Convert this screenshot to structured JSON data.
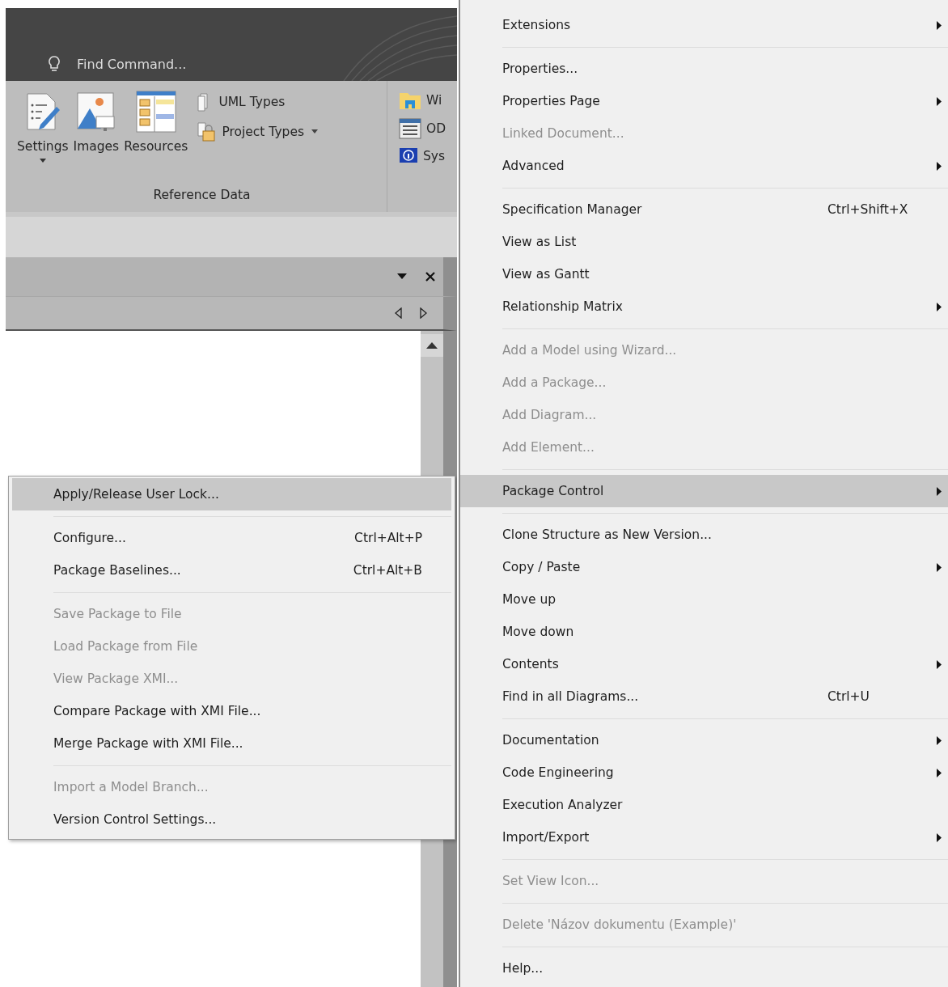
{
  "ribbon": {
    "search": {
      "placeholder": "Find Command..."
    },
    "large_buttons": [
      {
        "label": "Settings",
        "dropdown": true
      },
      {
        "label": "Images",
        "dropdown": false
      },
      {
        "label": "Resources",
        "dropdown": false
      }
    ],
    "small_buttons": [
      {
        "label": "UML Types",
        "dropdown": false
      },
      {
        "label": "Project Types",
        "dropdown": true
      }
    ],
    "group_label": "Reference Data",
    "next_group_buttons": [
      {
        "label": "Wi"
      },
      {
        "label": "OD"
      },
      {
        "label": "Sys"
      }
    ]
  },
  "context_menu": {
    "groups": [
      [
        {
          "label": "Extensions",
          "has_submenu": true,
          "disabled": false,
          "selected": false
        }
      ],
      [
        {
          "label": "Properties...",
          "has_submenu": false,
          "disabled": false,
          "selected": false
        },
        {
          "label": "Properties Page",
          "has_submenu": true,
          "disabled": false,
          "selected": false
        },
        {
          "label": "Linked Document...",
          "has_submenu": false,
          "disabled": true,
          "selected": false
        },
        {
          "label": "Advanced",
          "has_submenu": true,
          "disabled": false,
          "selected": false
        }
      ],
      [
        {
          "label": "Specification Manager",
          "shortcut": "Ctrl+Shift+X",
          "has_submenu": false,
          "disabled": false,
          "selected": false
        },
        {
          "label": "View as List",
          "has_submenu": false,
          "disabled": false,
          "selected": false
        },
        {
          "label": "View as Gantt",
          "has_submenu": false,
          "disabled": false,
          "selected": false
        },
        {
          "label": "Relationship Matrix",
          "has_submenu": true,
          "disabled": false,
          "selected": false
        }
      ],
      [
        {
          "label": "Add a Model using Wizard...",
          "has_submenu": false,
          "disabled": true,
          "selected": false
        },
        {
          "label": "Add a Package...",
          "has_submenu": false,
          "disabled": true,
          "selected": false
        },
        {
          "label": "Add Diagram...",
          "has_submenu": false,
          "disabled": true,
          "selected": false
        },
        {
          "label": "Add Element...",
          "has_submenu": false,
          "disabled": true,
          "selected": false
        }
      ],
      [
        {
          "label": "Package Control",
          "has_submenu": true,
          "disabled": false,
          "selected": true
        }
      ],
      [
        {
          "label": "Clone Structure as New Version...",
          "has_submenu": false,
          "disabled": false,
          "selected": false
        },
        {
          "label": "Copy / Paste",
          "has_submenu": true,
          "disabled": false,
          "selected": false
        },
        {
          "label": "Move up",
          "has_submenu": false,
          "disabled": false,
          "selected": false
        },
        {
          "label": "Move down",
          "has_submenu": false,
          "disabled": false,
          "selected": false
        },
        {
          "label": "Contents",
          "has_submenu": true,
          "disabled": false,
          "selected": false
        },
        {
          "label": "Find in all Diagrams...",
          "shortcut": "Ctrl+U",
          "has_submenu": false,
          "disabled": false,
          "selected": false
        }
      ],
      [
        {
          "label": "Documentation",
          "has_submenu": true,
          "disabled": false,
          "selected": false
        },
        {
          "label": "Code Engineering",
          "has_submenu": true,
          "disabled": false,
          "selected": false
        },
        {
          "label": "Execution Analyzer",
          "has_submenu": false,
          "disabled": false,
          "selected": false
        },
        {
          "label": "Import/Export",
          "has_submenu": true,
          "disabled": false,
          "selected": false
        }
      ],
      [
        {
          "label": "Set View Icon...",
          "has_submenu": false,
          "disabled": true,
          "selected": false
        }
      ],
      [
        {
          "label": "Delete 'Názov dokumentu (Example)'",
          "has_submenu": false,
          "disabled": true,
          "selected": false
        }
      ],
      [
        {
          "label": "Help...",
          "has_submenu": false,
          "disabled": false,
          "selected": false
        }
      ]
    ]
  },
  "submenu": {
    "groups": [
      [
        {
          "label": "Apply/Release User Lock...",
          "disabled": false,
          "selected": true
        }
      ],
      [
        {
          "label": "Configure...",
          "shortcut": "Ctrl+Alt+P",
          "disabled": false,
          "selected": false
        },
        {
          "label": "Package Baselines...",
          "shortcut": "Ctrl+Alt+B",
          "disabled": false,
          "selected": false
        }
      ],
      [
        {
          "label": "Save Package to File",
          "disabled": true,
          "selected": false
        },
        {
          "label": "Load Package from File",
          "disabled": true,
          "selected": false
        },
        {
          "label": "View Package XMI...",
          "disabled": true,
          "selected": false
        },
        {
          "label": "Compare Package with XMI File...",
          "disabled": false,
          "selected": false
        },
        {
          "label": "Merge Package with XMI File...",
          "disabled": false,
          "selected": false
        }
      ],
      [
        {
          "label": "Import a Model Branch...",
          "disabled": true,
          "selected": false
        },
        {
          "label": "Version Control Settings...",
          "disabled": false,
          "selected": false
        }
      ]
    ]
  }
}
